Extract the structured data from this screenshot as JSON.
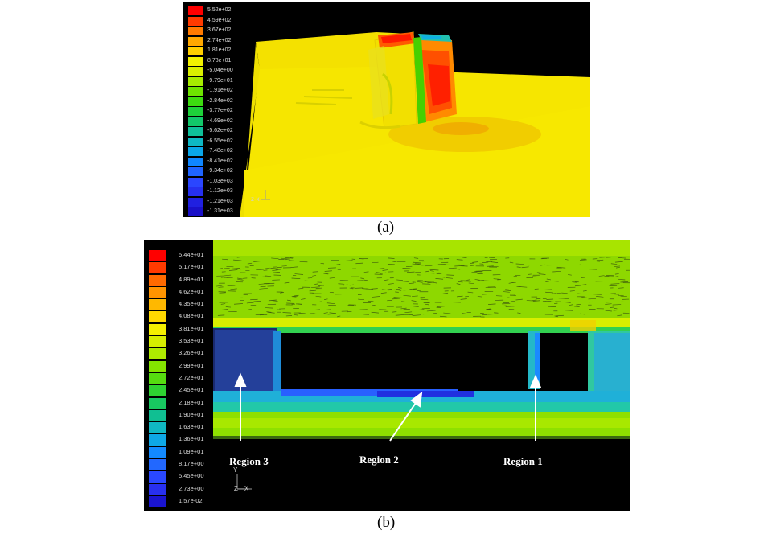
{
  "panel_a": {
    "caption": "(a)",
    "legend_labels": [
      "5.52e+02",
      "4.59e+02",
      "3.67e+02",
      "2.74e+02",
      "1.81e+02",
      "8.78e+01",
      "-5.04e+00",
      "-9.79e+01",
      "-1.91e+02",
      "-2.84e+02",
      "-3.77e+02",
      "-4.69e+02",
      "-5.62e+02",
      "-6.55e+02",
      "-7.48e+02",
      "-8.41e+02",
      "-9.34e+02",
      "-1.03e+03",
      "-1.12e+03",
      "-1.21e+03",
      "-1.31e+03"
    ],
    "legend_colors": [
      "#ff0000",
      "#ff3a00",
      "#ff7a00",
      "#ffa800",
      "#ffcf00",
      "#f2f200",
      "#d9f000",
      "#a6ec00",
      "#6ee400",
      "#3ddc10",
      "#1ed23a",
      "#12c86a",
      "#0fc09a",
      "#0eb8c4",
      "#0aa6e8",
      "#0f86ff",
      "#1f64ff",
      "#2a46ff",
      "#2630f0",
      "#2020e0",
      "#1a10c8"
    ],
    "axes_triad": "z-x"
  },
  "panel_b": {
    "caption": "(b)",
    "legend_labels": [
      "5.44e+01",
      "5.17e+01",
      "4.89e+01",
      "4.62e+01",
      "4.35e+01",
      "4.08e+01",
      "3.81e+01",
      "3.53e+01",
      "3.26e+01",
      "2.99e+01",
      "2.72e+01",
      "2.45e+01",
      "2.18e+01",
      "1.90e+01",
      "1.63e+01",
      "1.36e+01",
      "1.09e+01",
      "8.17e+00",
      "5.45e+00",
      "2.73e+00",
      "1.57e-02"
    ],
    "legend_colors": [
      "#ff0000",
      "#ff3a00",
      "#ff6a00",
      "#ff9400",
      "#ffb800",
      "#ffd900",
      "#f5f000",
      "#d6ee00",
      "#aeea00",
      "#84e400",
      "#56dc10",
      "#2ed232",
      "#18c860",
      "#10bf92",
      "#10b8c2",
      "#0ea8e6",
      "#138aff",
      "#2268ff",
      "#2a48ff",
      "#2830f0",
      "#1a14d0"
    ],
    "regions": [
      "Region 3",
      "Region 2",
      "Region 1"
    ],
    "axis_y": "Y",
    "axis_zx": "Z—X"
  },
  "colors": {
    "field_yellow": "#f5e400",
    "field_green": "#7ee000",
    "background": "#000000"
  }
}
